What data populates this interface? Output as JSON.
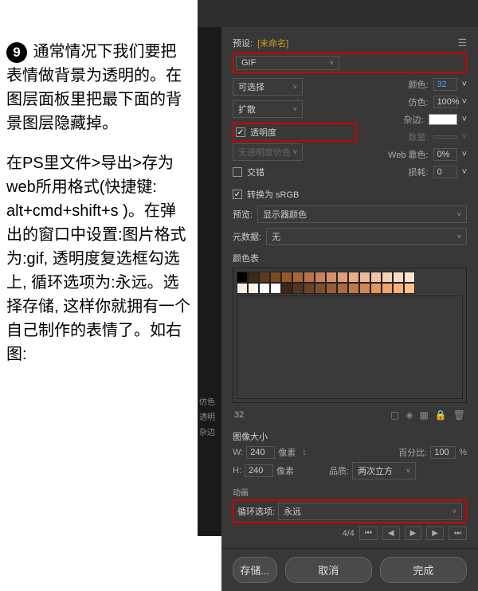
{
  "step_number": "9",
  "instruction_p1_part1": " 通常情况下我们要把表情做背景为透明的。在图层面板里把最下面的背景图层隐藏掉。",
  "instruction_p2": "在PS里文件>导出>存为web所用格式(快捷键: alt+cmd+shift+s )。在弹出的窗口中设置:图片格式为:gif, 透明度复选框勾选上, 循环选项为:永远。选择存储, 这样你就拥有一个自己制作的表情了。如右图:",
  "preset": {
    "label": "预设:",
    "name": "[未命名]"
  },
  "format": "GIF",
  "selectable": "可选择",
  "diffusion": "扩散",
  "colors_label": "颜色:",
  "colors_value": "32",
  "dither_label": "仿色:",
  "dither_value": "100%",
  "transparency": "透明度",
  "matte_label": "杂边:",
  "no_trans_dither": "无透明度仿色",
  "amount_label": "数量:",
  "interlace": "交错",
  "websnap_label": "Web 靠色:",
  "websnap_value": "0%",
  "lossy_label": "损耗:",
  "lossy_value": "0",
  "convert_srgb": "转换为 sRGB",
  "preview_label": "预览:",
  "preview_value": "显示器颜色",
  "metadata_label": "元数据:",
  "metadata_value": "无",
  "color_table_label": "颜色表",
  "palette_count": "32",
  "image_size_label": "图像大小",
  "width_label": "W:",
  "width_value": "240",
  "height_label": "H:",
  "height_value": "240",
  "pixels": "像素",
  "percent_label": "百分比:",
  "percent_value": "100",
  "percent_unit": "%",
  "quality_label": "品质:",
  "quality_value": "两次立方",
  "animation_label": "动画",
  "loop_label": "循环选项:",
  "loop_value": "永远",
  "frame_count": "4/4",
  "side_labels": {
    "dither": "仿色",
    "trans": "透明",
    "matte": "杂边"
  },
  "buttons": {
    "store": "存储...",
    "cancel": "取消",
    "done": "完成"
  }
}
